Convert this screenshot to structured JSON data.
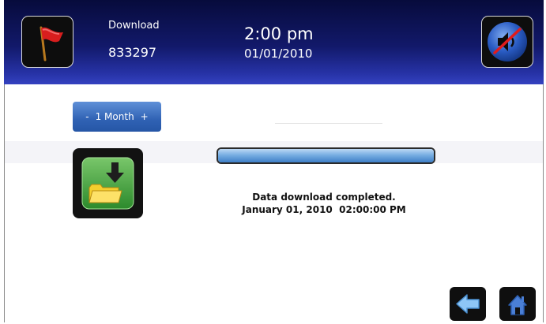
{
  "header": {
    "title": "Download",
    "serial": "833297",
    "time": "2:00 pm",
    "date": "01/01/2010",
    "flag_icon": "red-flag-icon",
    "mute_icon": "speaker-muted-icon"
  },
  "period_selector": {
    "minus": "-",
    "label": "1 Month",
    "plus": "+"
  },
  "progress": {
    "percent": 100
  },
  "status": {
    "line1": "Data download completed.",
    "line2": "January 01, 2010  02:00:00 PM"
  },
  "icons": {
    "download": "folder-download-icon",
    "back": "back-arrow-icon",
    "home": "home-icon"
  },
  "colors": {
    "header_dark": "#070b3c",
    "header_light": "#3442c0",
    "button_blue": "#3062b4",
    "progress_blue": "#5a9ad8"
  }
}
